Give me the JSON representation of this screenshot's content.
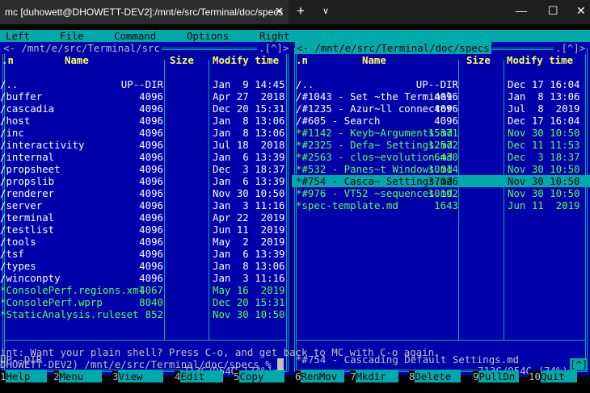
{
  "window": {
    "tab_title": "mc [duhowett@DHOWETT-DEV2]:/mnt/e/src/Terminal/doc/specs",
    "tab_close": "✕",
    "new_tab": "+",
    "dropdown": "∨",
    "minimize": "—",
    "maximize": "☐",
    "close": "✕"
  },
  "menu": [
    "Left",
    "File",
    "Command",
    "Options",
    "Right"
  ],
  "left_panel": {
    "path": "<- /mnt/e/src/Terminal/src",
    "corner": ".[^]>",
    "headers": {
      "n": ".n",
      "name": "Name",
      "size": "Size",
      "mtime": "Modify time"
    },
    "rows": [
      {
        "name": "/..",
        "size": "UP--DIR",
        "date": "Jan  9 14:45",
        "type": "dir"
      },
      {
        "name": "/buffer",
        "size": "4096",
        "date": "Apr 27  2018",
        "type": "dir"
      },
      {
        "name": "/cascadia",
        "size": "4096",
        "date": "Dec 20 15:31",
        "type": "dir"
      },
      {
        "name": "/host",
        "size": "4096",
        "date": "Jan  8 13:06",
        "type": "dir"
      },
      {
        "name": "/inc",
        "size": "4096",
        "date": "Jan  8 13:06",
        "type": "dir"
      },
      {
        "name": "/interactivity",
        "size": "4096",
        "date": "Jul 18  2018",
        "type": "dir"
      },
      {
        "name": "/internal",
        "size": "4096",
        "date": "Jan  6 13:39",
        "type": "dir"
      },
      {
        "name": "/propsheet",
        "size": "4096",
        "date": "Dec  3 18:37",
        "type": "dir"
      },
      {
        "name": "/propslib",
        "size": "4096",
        "date": "Jan  6 13:39",
        "type": "dir"
      },
      {
        "name": "/renderer",
        "size": "4096",
        "date": "Nov 30 10:50",
        "type": "dir"
      },
      {
        "name": "/server",
        "size": "4096",
        "date": "Jan  3 11:16",
        "type": "dir"
      },
      {
        "name": "/terminal",
        "size": "4096",
        "date": "Apr 22  2019",
        "type": "dir"
      },
      {
        "name": "/testlist",
        "size": "4096",
        "date": "Jun 11  2019",
        "type": "dir"
      },
      {
        "name": "/tools",
        "size": "4096",
        "date": "May  2  2019",
        "type": "dir"
      },
      {
        "name": "/tsf",
        "size": "4096",
        "date": "Jan  6 13:39",
        "type": "dir"
      },
      {
        "name": "/types",
        "size": "4096",
        "date": "Jan  8 13:06",
        "type": "dir"
      },
      {
        "name": "/winconpty",
        "size": "4096",
        "date": "Jan  3 11:16",
        "type": "dir"
      },
      {
        "name": "*ConsolePerf.regions.xml",
        "size": "4067",
        "date": "May 16  2019",
        "type": "exec"
      },
      {
        "name": "*ConsolePerf.wprp",
        "size": "8040",
        "date": "Dec 20 15:31",
        "type": "exec"
      },
      {
        "name": "*StaticAnalysis.ruleset",
        "size": "852",
        "date": "Nov 30 10:50",
        "type": "exec"
      }
    ],
    "mini_status": "UP--DIR",
    "disk": "713G/954G (74%)"
  },
  "right_panel": {
    "path": "<- /mnt/e/src/Terminal/doc/specs",
    "corner": ".[^]>",
    "headers": {
      "n": ".n",
      "name": "Name",
      "size": "Size",
      "mtime": "Modify time"
    },
    "rows": [
      {
        "name": "/..",
        "size": "UP--DIR",
        "date": "Dec 17 16:04",
        "type": "dir"
      },
      {
        "name": "/#1043 - Set ~the Terminal",
        "size": "4096",
        "date": "Jan  8 13:06",
        "type": "dir"
      },
      {
        "name": "/#1235 - Azur~ll connector",
        "size": "4096",
        "date": "Jul  8  2019",
        "type": "dir"
      },
      {
        "name": "/#605 - Search",
        "size": "4096",
        "date": "Dec 17 16:04",
        "type": "dir"
      },
      {
        "name": "*#1142 - Keyb~Arguments.md",
        "size": "15371",
        "date": "Nov 30 10:50",
        "type": "exec"
      },
      {
        "name": "*#2325 - Defa~ Settings.md",
        "size": "12572",
        "date": "Dec 11 11:53",
        "type": "exec"
      },
      {
        "name": "*#2563 - clos~evolution.md",
        "size": "6430",
        "date": "Dec  3 18:37",
        "type": "exec"
      },
      {
        "name": "*#532 - Panes~t Windows.md",
        "size": "10014",
        "date": "Nov 30 10:50",
        "type": "exec"
      },
      {
        "name": "*#754 - Casca~ Settings.md",
        "size": "37026",
        "date": "Nov 30 10:50",
        "type": "exec",
        "selected": true
      },
      {
        "name": "*#976 - VT52 ~sequences.md",
        "size": "10192",
        "date": "Nov 30 10:50",
        "type": "exec"
      },
      {
        "name": "*spec-template.md",
        "size": "1643",
        "date": "Jun 11  2019",
        "type": "exec"
      }
    ],
    "mini_status": "*#754 - Cascading Default Settings.md",
    "disk": "713G/954G (74%)"
  },
  "hint": "int: Want your plain shell? Press C-o, and get back to MC with C-o again.",
  "prompt": "DHOWETT-DEV2) /mnt/e/src/Terminal/doc/specs % ",
  "prompt_corner": "[^]",
  "fkeys": [
    {
      "n": "1",
      "label": "Help"
    },
    {
      "n": "2",
      "label": "Menu"
    },
    {
      "n": "3",
      "label": "View"
    },
    {
      "n": "4",
      "label": "Edit"
    },
    {
      "n": "5",
      "label": "Copy"
    },
    {
      "n": "6",
      "label": "RenMov"
    },
    {
      "n": "7",
      "label": "Mkdir"
    },
    {
      "n": "8",
      "label": "Delete"
    },
    {
      "n": "9",
      "label": "PullDn"
    },
    {
      "n": "10",
      "label": "Quit"
    }
  ]
}
